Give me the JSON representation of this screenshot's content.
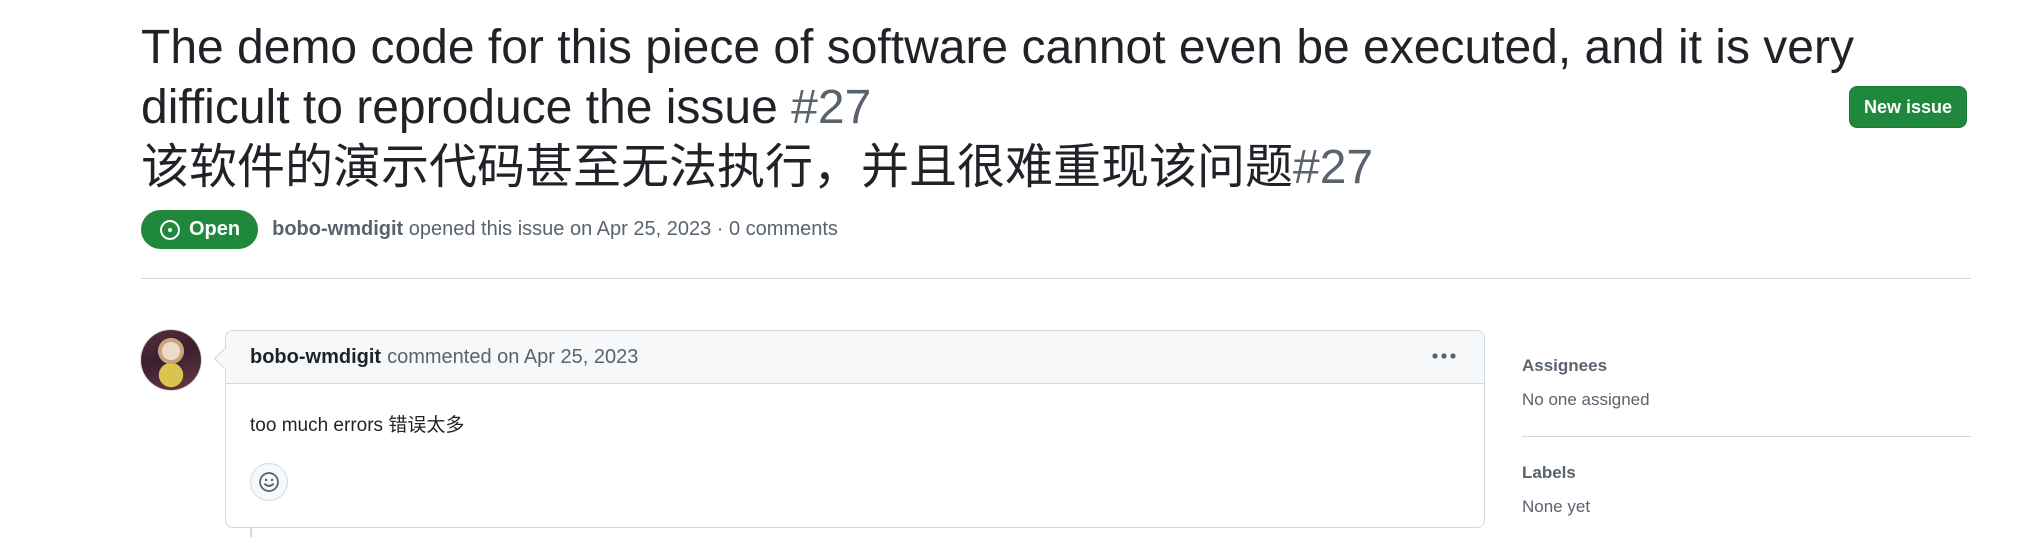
{
  "issue": {
    "title": "The demo code for this piece of software cannot even be executed, and it is very difficult to reproduce the issue",
    "number": "#27",
    "title_cn": "该软件的演示代码甚至无法执行，并且很难重现该问题",
    "number_cn": "#27",
    "new_issue_label": "New issue",
    "state_label": "Open",
    "author": "bobo-wmdigit",
    "opened_text": "opened this issue on Apr 25, 2023 · 0 comments"
  },
  "comment": {
    "author": "bobo-wmdigit",
    "timestamp": "commented on Apr 25, 2023",
    "body": "too much errors  错误太多"
  },
  "sidebar": {
    "assignees_heading": "Assignees",
    "assignees_value": "No one assigned",
    "labels_heading": "Labels",
    "labels_value": "None yet"
  },
  "colors": {
    "open_green": "#1f883d",
    "muted_text": "#59636e",
    "border": "#d1d9e0"
  },
  "icons": {
    "state": "issue-opened-icon",
    "menu": "kebab-horizontal-icon",
    "reaction": "smiley-icon"
  }
}
